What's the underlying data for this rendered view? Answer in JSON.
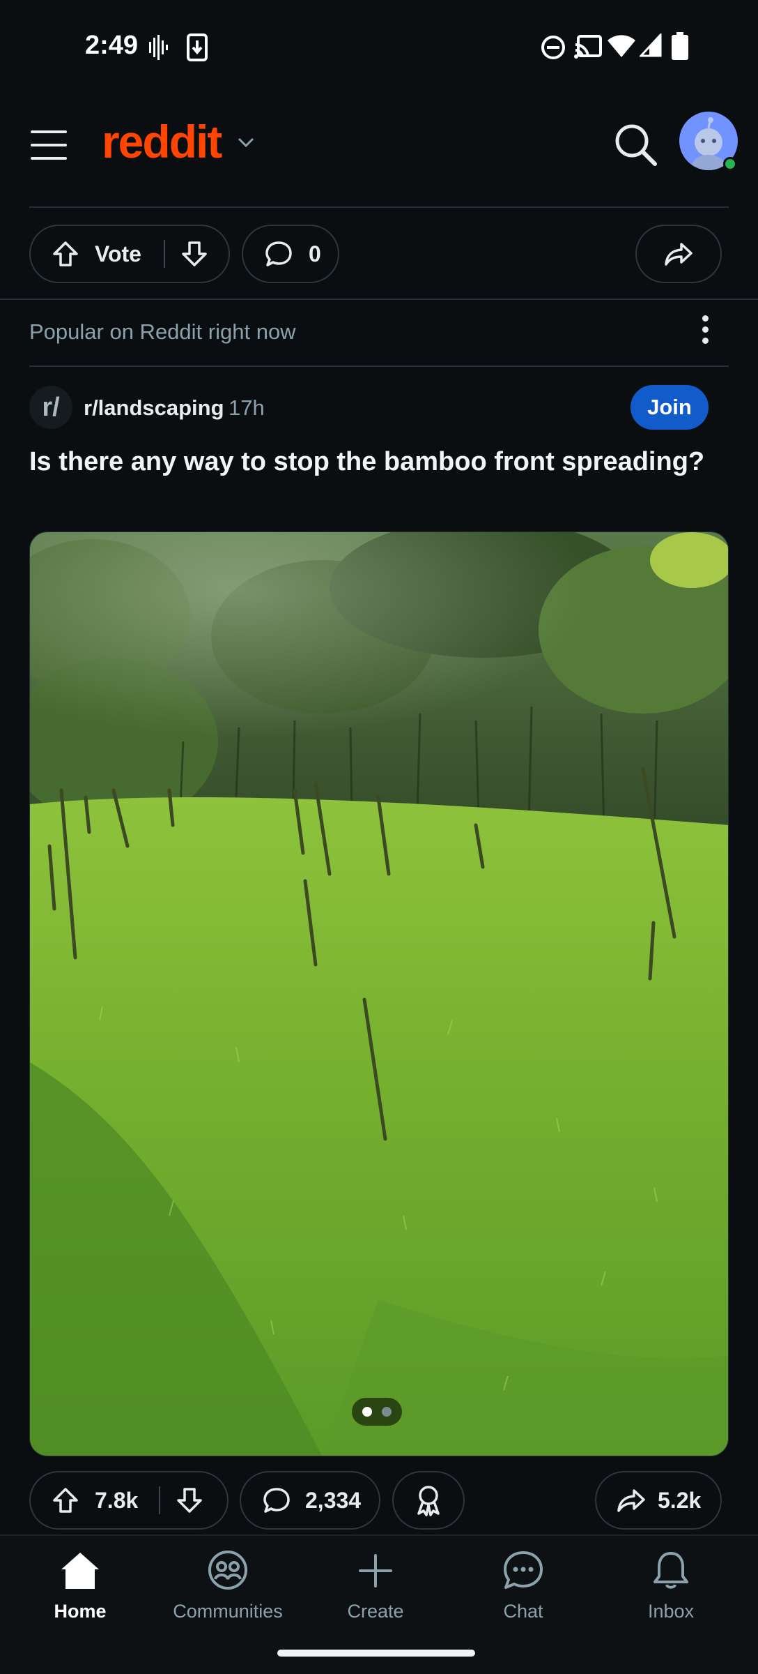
{
  "status_bar": {
    "time": "2:49",
    "icons": [
      "voicemail-icon",
      "download-icon",
      "dnd-icon",
      "cast-icon",
      "wifi-icon",
      "signal-icon",
      "battery-icon"
    ]
  },
  "header": {
    "logo_text": "reddit",
    "icons": [
      "menu-icon",
      "chevron-down-icon",
      "search-icon",
      "avatar"
    ]
  },
  "prev_post_actions": {
    "vote_label": "Vote",
    "comment_count": "0"
  },
  "feed": {
    "section_label": "Popular on Reddit right now"
  },
  "post": {
    "subreddit_icon_text": "r/",
    "subreddit": "r/landscaping",
    "age": "17h",
    "join_label": "Join",
    "title": "Is there any way to stop the bamboo front spreading?",
    "image_count": 2,
    "active_image_index": 0,
    "votes": "7.8k",
    "comments": "2,334",
    "shares": "5.2k"
  },
  "bottom_nav": {
    "items": [
      {
        "label": "Home",
        "icon": "home-icon"
      },
      {
        "label": "Communities",
        "icon": "communities-icon"
      },
      {
        "label": "Create",
        "icon": "plus-icon"
      },
      {
        "label": "Chat",
        "icon": "chat-icon"
      },
      {
        "label": "Inbox",
        "icon": "bell-icon"
      }
    ],
    "active": "Home"
  },
  "colors": {
    "background": "#0b0e11",
    "brand": "#ff4500",
    "join": "#115bca",
    "muted_text": "#8ba2ad",
    "online": "#2bb351"
  }
}
